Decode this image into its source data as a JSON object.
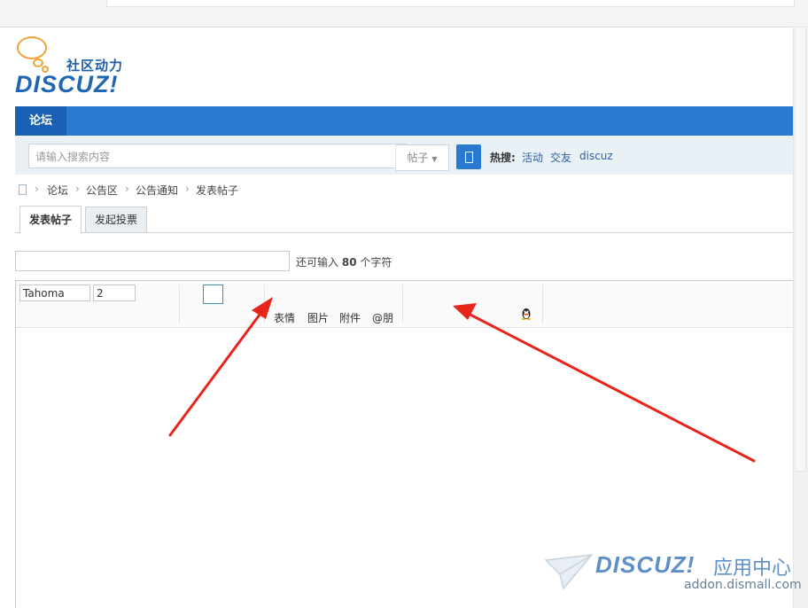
{
  "logo": {
    "cn_text": "社区动力",
    "word": "DISCUZ!"
  },
  "nav": {
    "items": [
      {
        "label": "论坛"
      }
    ]
  },
  "search": {
    "placeholder": "请输入搜索内容",
    "type_label": "帖子",
    "hot_label": "热搜:",
    "hot_links": [
      "活动",
      "交友",
      "discuz"
    ]
  },
  "breadcrumb": [
    "论坛",
    "公告区",
    "公告通知",
    "发表帖子"
  ],
  "tabs": [
    {
      "label": "发表帖子",
      "active": true
    },
    {
      "label": "发起投票",
      "active": false
    }
  ],
  "subject": {
    "hint_prefix": "还可输入",
    "remaining": "80",
    "hint_suffix": "个字符"
  },
  "editor": {
    "font": "Tahoma",
    "size": "2",
    "toolbar_items": [
      "表情",
      "图片",
      "附件",
      "@朋"
    ]
  },
  "watermark": {
    "word": "DISCUZ!",
    "cn": "应用中心",
    "url": "addon.dismall.com"
  },
  "colors": {
    "nav": "#2b7ad1",
    "nav_active": "#1a61b6",
    "arrow": "#e8251b"
  }
}
